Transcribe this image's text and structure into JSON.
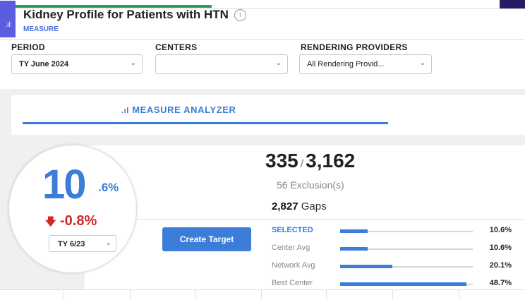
{
  "header": {
    "title": "Kidney Profile for Patients with HTN",
    "subtitle": "MEASURE",
    "info_glyph": "i"
  },
  "filters": {
    "period": {
      "label": "PERIOD",
      "value": "TY June 2024"
    },
    "centers": {
      "label": "CENTERS",
      "value": ""
    },
    "providers": {
      "label": "RENDERING PROVIDERS",
      "value": "All Rendering Provid..."
    }
  },
  "tab": {
    "label": "MEASURE ANALYZER"
  },
  "score": {
    "whole": "10",
    "decimal": ".6%",
    "change": "-0.8%",
    "compare_value": "TY 6/23"
  },
  "summary": {
    "numerator": "335",
    "denominator": "3,162",
    "exclusions": "56  Exclusion(s)",
    "gaps_value": "2,827",
    "gaps_label": "Gaps"
  },
  "button": {
    "create_target": "Create Target"
  },
  "comparison": [
    {
      "label": "SELECTED",
      "value": "10.6%",
      "fraction": 0.106
    },
    {
      "label": "Center Avg",
      "value": "10.6%",
      "fraction": 0.106
    },
    {
      "label": "Network Avg",
      "value": "20.1%",
      "fraction": 0.201
    },
    {
      "label": "Best Center",
      "value": "48.7%",
      "fraction": 0.487
    }
  ],
  "colors": {
    "accent": "#3b7dd8",
    "negative": "#d02828",
    "brand": "#5b5ce0"
  }
}
